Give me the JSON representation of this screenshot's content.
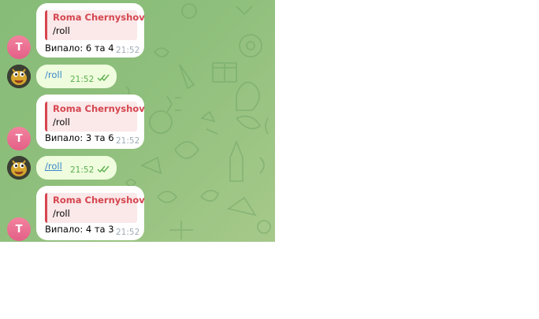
{
  "theme": {
    "chat_background": "#8fbf7c",
    "incoming_bubble": "#ffffff",
    "outgoing_bubble": "#effdde",
    "reply_accent": "#d5464f",
    "link_color": "#3a86c6",
    "read_check_color": "#5daf4f"
  },
  "messages": [
    {
      "direction": "incoming",
      "avatar_letter": "T",
      "reply_author": "Roma Chernyshov",
      "reply_text": "/roll",
      "text": "Випало: 6 та 4",
      "time": "21:52"
    },
    {
      "direction": "outgoing",
      "avatar_icon": "bot-avatar-icon",
      "text": "/roll",
      "time": "21:52",
      "status_icon": "double-check-icon"
    },
    {
      "direction": "incoming",
      "avatar_letter": "T",
      "reply_author": "Roma Chernyshov",
      "reply_text": "/roll",
      "text": "Випало: 3 та 6",
      "time": "21:52"
    },
    {
      "direction": "outgoing",
      "avatar_icon": "bot-avatar-icon",
      "text": "/roll",
      "time": "21:52",
      "status_icon": "double-check-icon"
    },
    {
      "direction": "incoming",
      "avatar_letter": "T",
      "reply_author": "Roma Chernyshov",
      "reply_text": "/roll",
      "text": "Випало: 4 та 3",
      "time": "21:52"
    }
  ]
}
